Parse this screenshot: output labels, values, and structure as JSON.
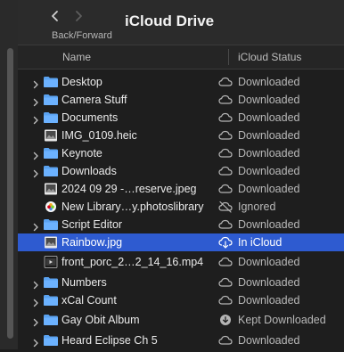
{
  "toolbar": {
    "title": "iCloud Drive",
    "nav_label": "Back/Forward"
  },
  "columns": {
    "name": "Name",
    "status": "iCloud Status"
  },
  "colors": {
    "folder": "#5aa2f0",
    "selected": "#2e5bd0"
  },
  "rows": [
    {
      "name": "Desktop",
      "status": "Downloaded",
      "icon": "folder-icon",
      "status_icon": "cloud-icon",
      "expandable": true
    },
    {
      "name": "Camera Stuff",
      "status": "Downloaded",
      "icon": "folder-icon",
      "status_icon": "cloud-icon",
      "expandable": true
    },
    {
      "name": "Documents",
      "status": "Downloaded",
      "icon": "folder-icon",
      "status_icon": "cloud-icon",
      "expandable": true
    },
    {
      "name": "IMG_0109.heic",
      "status": "Downloaded",
      "icon": "image-file-icon",
      "status_icon": "cloud-icon",
      "expandable": false
    },
    {
      "name": "Keynote",
      "status": "Downloaded",
      "icon": "folder-icon",
      "status_icon": "cloud-icon",
      "expandable": true
    },
    {
      "name": "Downloads",
      "status": "Downloaded",
      "icon": "folder-icon",
      "status_icon": "cloud-icon",
      "expandable": true
    },
    {
      "name": "2024 09 29 -…reserve.jpeg",
      "status": "Downloaded",
      "icon": "image-file-icon",
      "status_icon": "cloud-icon",
      "expandable": false
    },
    {
      "name": "New Library…y.photoslibrary",
      "status": "Ignored",
      "icon": "photos-library-icon",
      "status_icon": "cloud-slash-icon",
      "expandable": false
    },
    {
      "name": "Script Editor",
      "status": "Downloaded",
      "icon": "folder-icon",
      "status_icon": "cloud-icon",
      "expandable": true
    },
    {
      "name": "Rainbow.jpg",
      "status": "In iCloud",
      "icon": "image-file-icon",
      "status_icon": "cloud-download-icon",
      "expandable": false,
      "selected": true
    },
    {
      "name": "front_porc_2…2_14_16.mp4",
      "status": "Downloaded",
      "icon": "video-file-icon",
      "status_icon": "cloud-icon",
      "expandable": false
    },
    {
      "name": "Numbers",
      "status": "Downloaded",
      "icon": "folder-icon",
      "status_icon": "cloud-icon",
      "expandable": true
    },
    {
      "name": "xCal Count",
      "status": "Downloaded",
      "icon": "folder-icon",
      "status_icon": "cloud-icon",
      "expandable": true
    },
    {
      "name": "Gay Obit Album",
      "status": "Kept Downloaded",
      "icon": "folder-icon",
      "status_icon": "kept-download-icon",
      "expandable": true
    },
    {
      "name": "Heard Eclipse Ch 5",
      "status": "Downloaded",
      "icon": "folder-icon",
      "status_icon": "cloud-icon",
      "expandable": true
    }
  ]
}
